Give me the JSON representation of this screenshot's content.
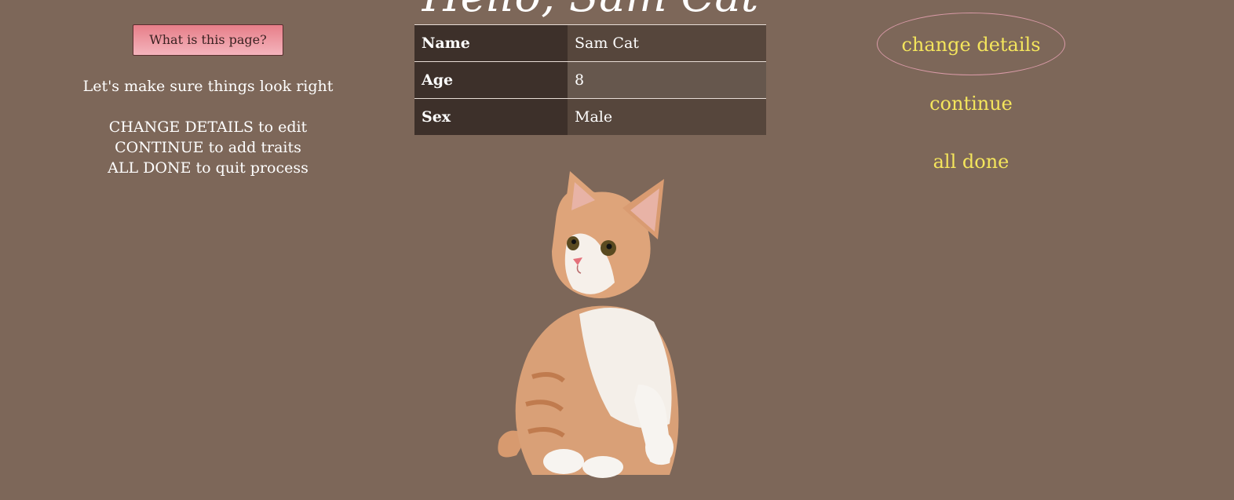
{
  "header": {
    "title": "Hello, Sam Cat"
  },
  "help": {
    "button_label": "What is this page?"
  },
  "intro": {
    "text": "Let's make sure things look right",
    "instructions": [
      "CHANGE DETAILS to edit",
      "CONTINUE to add traits",
      "ALL DONE to quit process"
    ]
  },
  "details": {
    "rows": [
      {
        "label": "Name",
        "value": "Sam Cat"
      },
      {
        "label": "Age",
        "value": "8"
      },
      {
        "label": "Sex",
        "value": "Male"
      }
    ]
  },
  "image": {
    "icon": "kitten-image"
  },
  "nav": {
    "change_details": "change details",
    "continue": "continue",
    "all_done": "all done"
  },
  "colors": {
    "background": "#7d6759",
    "link": "#f4e55c",
    "button_top": "#e77e89",
    "button_bottom": "#f4b4bc",
    "table_key_bg": "#3d302a",
    "focus_ring": "#d99aa7"
  }
}
